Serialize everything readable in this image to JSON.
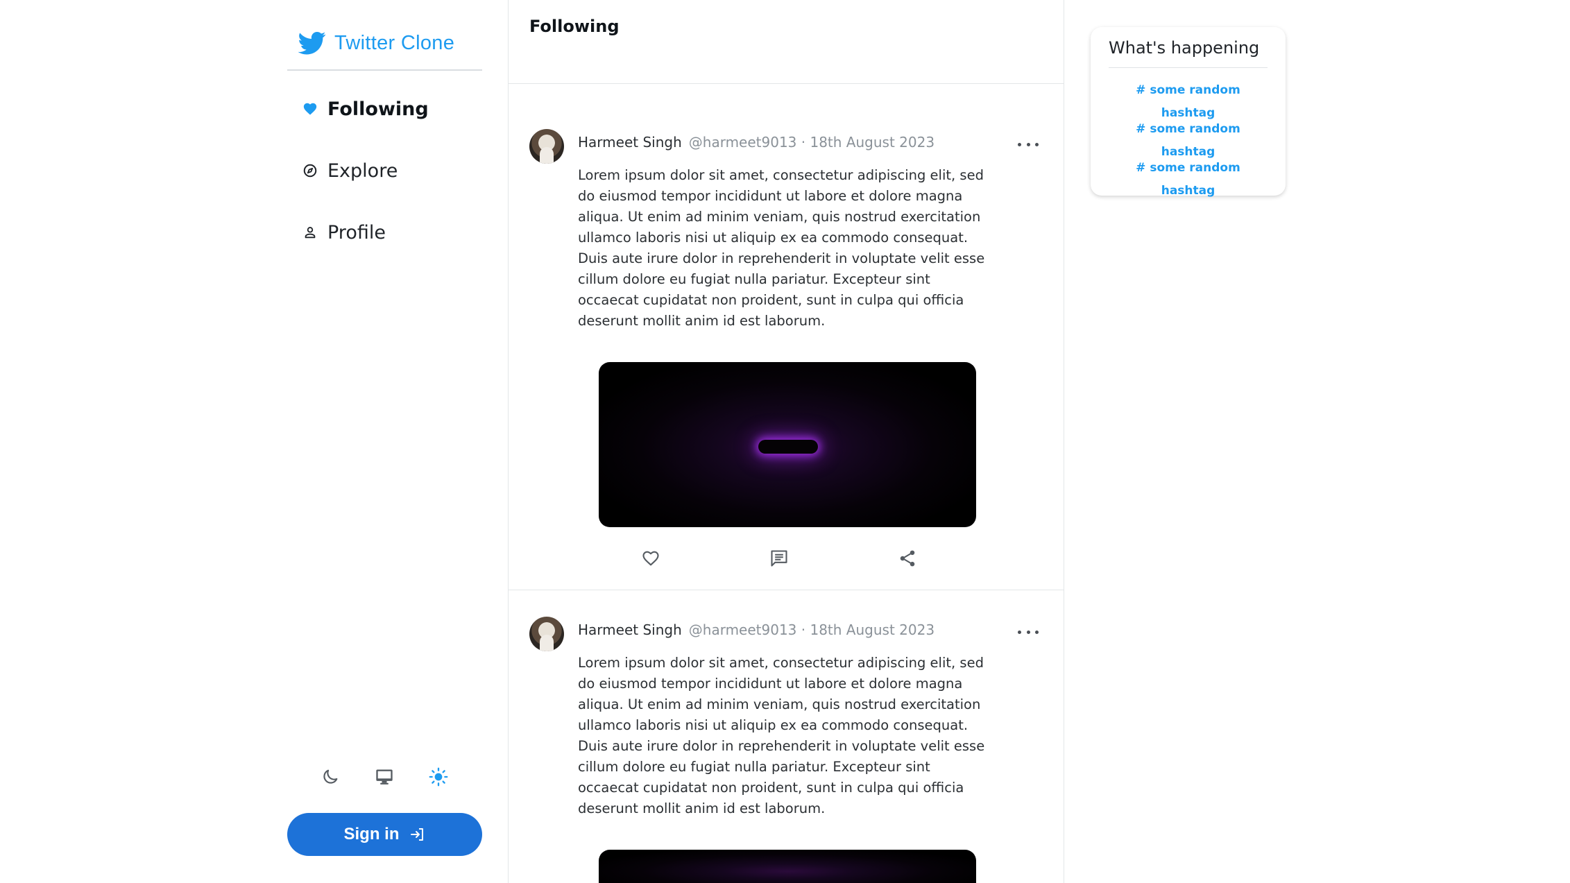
{
  "brand": {
    "name": "Twitter Clone",
    "icon": "twitter-bird-icon",
    "color": "#1d9bf0"
  },
  "nav": [
    {
      "label": "Following",
      "icon": "heart-icon",
      "active": true
    },
    {
      "label": "Explore",
      "icon": "compass-icon",
      "active": false
    },
    {
      "label": "Profile",
      "icon": "user-icon",
      "active": false
    }
  ],
  "theme_options": [
    {
      "name": "dark",
      "icon": "moon-icon",
      "selected": false
    },
    {
      "name": "system",
      "icon": "monitor-icon",
      "selected": false
    },
    {
      "name": "light",
      "icon": "sun-icon",
      "selected": true
    }
  ],
  "signin": {
    "label": "Sign in",
    "icon": "sign-in-icon",
    "color": "#1d72d8"
  },
  "feed": {
    "title": "Following",
    "tweets": [
      {
        "name": "Harmeet Singh",
        "handle_date": "@harmeet9013 · 18th August 2023",
        "text": "Lorem ipsum dolor sit amet, consectetur adipiscing elit, sed do eiusmod tempor incididunt ut labore et dolore magna aliqua. Ut enim ad minim veniam, quis nostrud exercitation ullamco laboris nisi ut aliquip ex ea commodo consequat. Duis aute irure dolor in reprehenderit in voluptate velit esse cillum dolore eu fugiat nulla pariatur. Excepteur sint occaecat cupidatat non proident, sunt in culpa qui officia deserunt mollit anim id est laborum."
      },
      {
        "name": "Harmeet Singh",
        "handle_date": "@harmeet9013 · 18th August 2023",
        "text": "Lorem ipsum dolor sit amet, consectetur adipiscing elit, sed do eiusmod tempor incididunt ut labore et dolore magna aliqua. Ut enim ad minim veniam, quis nostrud exercitation ullamco laboris nisi ut aliquip ex ea commodo consequat. Duis aute irure dolor in reprehenderit in voluptate velit esse cillum dolore eu fugiat nulla pariatur. Excepteur sint occaecat cupidatat non proident, sunt in culpa qui officia deserunt mollit anim id est laborum."
      }
    ],
    "actions": [
      "heart-outline-icon",
      "comment-icon",
      "share-icon"
    ]
  },
  "trends": {
    "title": "What's happening",
    "items": [
      "# some random hashtag",
      "# some random hashtag",
      "# some random hashtag"
    ]
  }
}
